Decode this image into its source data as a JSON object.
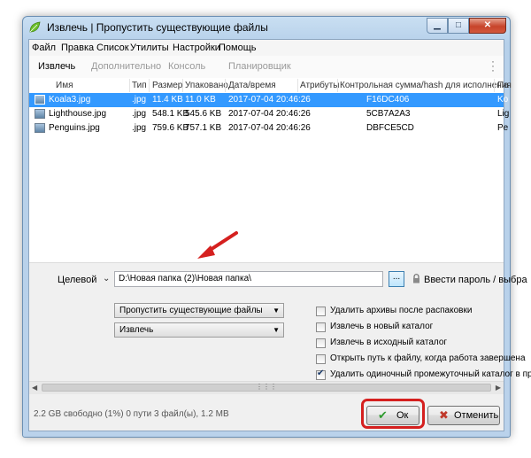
{
  "window": {
    "title": "Извлечь | Пропустить существующие файлы",
    "controls": {
      "minimize": "▁",
      "maximize": "□",
      "close": "✕"
    }
  },
  "menu": [
    "Файл",
    "Правка",
    "Список",
    "Утилиты",
    "Настройки",
    "Помощь"
  ],
  "toolbar": {
    "tabs": [
      "Извлечь",
      "Дополнительно",
      "Консоль",
      "Планировщик"
    ],
    "more_icon": "vertical-dots-icon"
  },
  "file_list": {
    "columns": [
      "Имя",
      "Тип",
      "Размер",
      "Упаковано",
      "Дата/время",
      "Атрибуты",
      "Контрольная сумма/hash для исполнения",
      "Па"
    ],
    "rows": [
      {
        "name": "Koala3.jpg",
        "type": ".jpg",
        "size": "11.4 KB",
        "packed": "11.0 KB",
        "datetime": "2017-07-04 20:46:26",
        "attrs": "",
        "checksum": "F16DC406",
        "path": "Ko",
        "selected": true
      },
      {
        "name": "Lighthouse.jpg",
        "type": ".jpg",
        "size": "548.1 KB",
        "packed": "545.6 KB",
        "datetime": "2017-07-04 20:46:26",
        "attrs": "",
        "checksum": "5CB7A2A3",
        "path": "Lig",
        "selected": false
      },
      {
        "name": "Penguins.jpg",
        "type": ".jpg",
        "size": "759.6 KB",
        "packed": "757.1 KB",
        "datetime": "2017-07-04 20:46:26",
        "attrs": "",
        "checksum": "DBFCE5CD",
        "path": "Pe",
        "selected": false
      }
    ]
  },
  "options": {
    "target_label": "Целевой",
    "target_path": "D:\\Новая папка (2)\\Новая папка\\",
    "browse_label": "...",
    "password_label": "Ввести пароль / выбра",
    "overwrite_mode": "Пропустить существующие файлы",
    "action_mode": "Извлечь",
    "checkboxes": [
      {
        "label": "Удалить архивы после распаковки",
        "checked": false
      },
      {
        "label": "Извлечь в новый каталог",
        "checked": false
      },
      {
        "label": "Извлечь в исходный каталог",
        "checked": false
      },
      {
        "label": "Открыть путь к файлу, когда работа завершена",
        "checked": false
      },
      {
        "label": "Удалить одиночный промежуточный каталог в пр",
        "checked": true
      }
    ]
  },
  "status": "2.2 GB свободно (1%)    0 пути 3 файл(ы), 1.2 MB",
  "buttons": {
    "ok": "Ок",
    "cancel": "Отменить"
  },
  "colors": {
    "selection": "#3399ff",
    "highlight": "#d5201f",
    "ok_icon": "#2e9a2e",
    "cancel_icon": "#c0392b"
  }
}
